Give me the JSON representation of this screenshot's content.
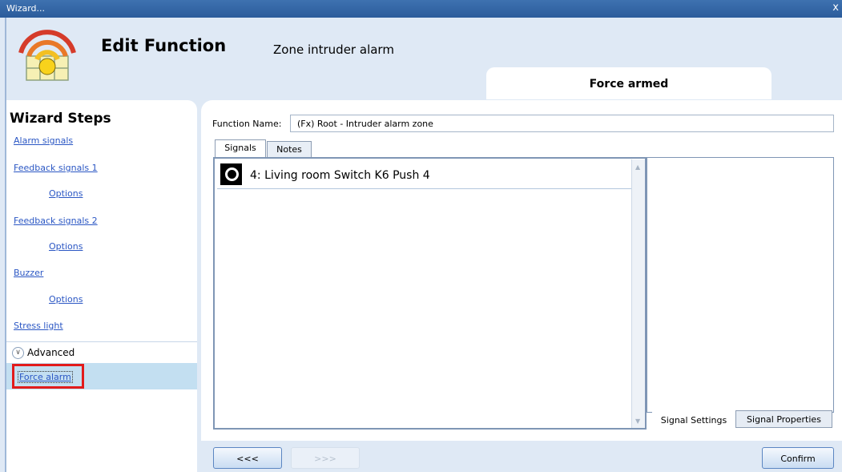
{
  "window": {
    "title": "Wizard...",
    "close_glyph": "x"
  },
  "header": {
    "title": "Edit Function",
    "subtitle": "Zone intruder alarm",
    "app_icon": "alarm-wifi-icon"
  },
  "step": {
    "label": "Force armed"
  },
  "wizard_steps": {
    "title": "Wizard Steps",
    "items": [
      {
        "label": "Alarm signals"
      },
      {
        "label": "Feedback signals 1"
      },
      {
        "label": "Options"
      },
      {
        "label": "Feedback signals 2"
      },
      {
        "label": "Options"
      },
      {
        "label": "Buzzer"
      },
      {
        "label": "Options"
      },
      {
        "label": "Stress light"
      }
    ],
    "advanced": {
      "label": "Advanced",
      "icon": "chevron-down-circle-icon"
    },
    "selected": {
      "label": "Force alarm"
    }
  },
  "function_name": {
    "label": "Function Name:",
    "value": "(Fx) Root - Intruder alarm zone"
  },
  "tabs": [
    {
      "label": "Signals"
    },
    {
      "label": "Notes"
    }
  ],
  "signals": [
    {
      "text": "4: Living room Switch K6 Push 4",
      "icon": "push-button-icon"
    }
  ],
  "property_tabs": [
    {
      "label": "Signal Settings"
    },
    {
      "label": "Signal Properties"
    }
  ],
  "nav": {
    "back_label": "<<<",
    "next_label": ">>>",
    "confirm_label": "Confirm"
  },
  "colors": {
    "titlebar": "#2f64a6",
    "link": "#2b57c4",
    "selection": "#c3dff1",
    "highlight": "#e21b1b"
  }
}
